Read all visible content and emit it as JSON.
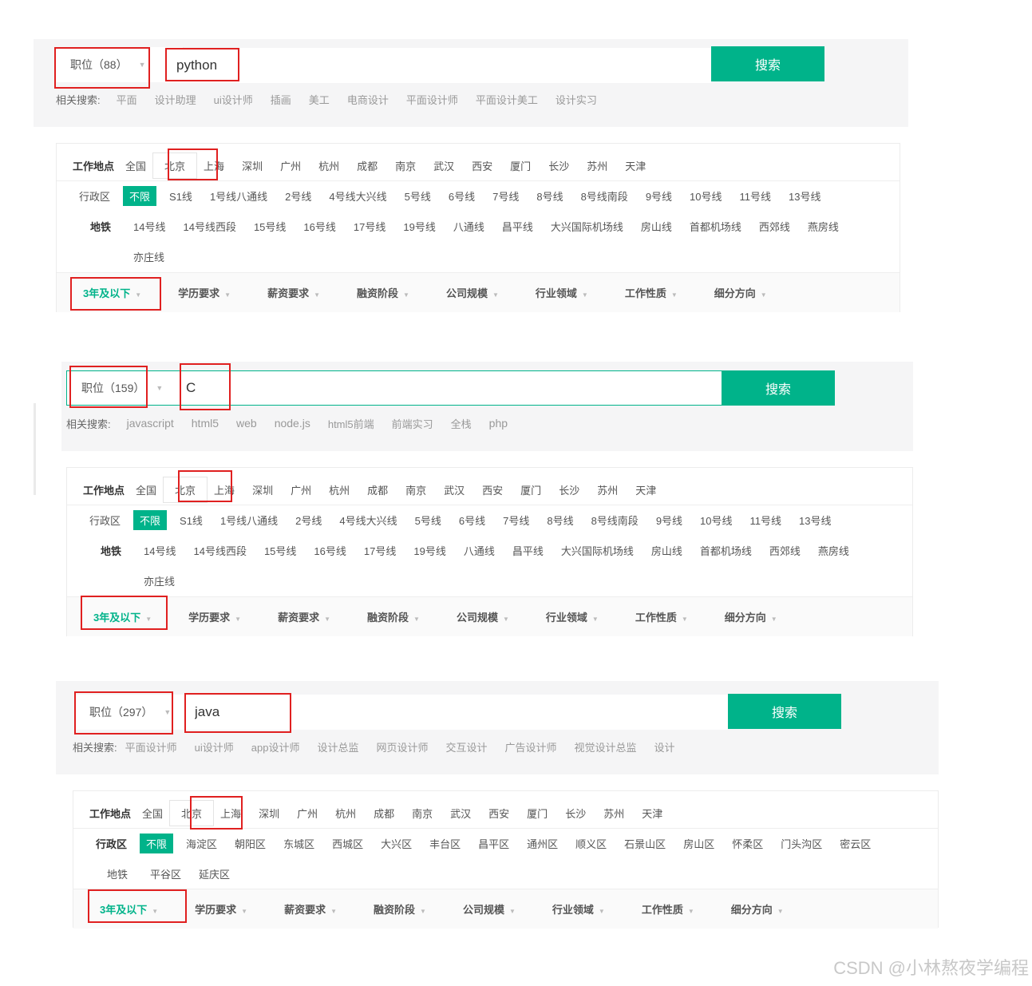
{
  "block1": {
    "position_label": "职位（88）",
    "query": "python",
    "search_button": "搜索",
    "related_label": "相关搜索:",
    "related": [
      "平面",
      "设计助理",
      "ui设计师",
      "插画",
      "美工",
      "电商设计",
      "平面设计师",
      "平面设计美工",
      "设计实习"
    ],
    "location_label": "工作地点",
    "cities": [
      "全国",
      "北京",
      "上海",
      "深圳",
      "广州",
      "杭州",
      "成都",
      "南京",
      "武汉",
      "西安",
      "厦门",
      "长沙",
      "苏州",
      "天津"
    ],
    "district_label": "行政区",
    "unlimited": "不限",
    "subway_label": "地铁",
    "lines_row1": [
      "S1线",
      "1号线八通线",
      "2号线",
      "4号线大兴线",
      "5号线",
      "6号线",
      "7号线",
      "8号线",
      "8号线南段",
      "9号线",
      "10号线",
      "11号线",
      "13号线"
    ],
    "lines_row2": [
      "14号线",
      "14号线西段",
      "15号线",
      "16号线",
      "17号线",
      "19号线",
      "八通线",
      "昌平线",
      "大兴国际机场线",
      "房山线",
      "首都机场线",
      "西郊线",
      "燕房线"
    ],
    "lines_row3": [
      "亦庄线"
    ],
    "bottom": [
      "3年及以下",
      "学历要求",
      "薪资要求",
      "融资阶段",
      "公司规模",
      "行业领域",
      "工作性质",
      "细分方向"
    ]
  },
  "block2": {
    "position_label": "职位（159）",
    "query": "C",
    "search_button": "搜索",
    "related_label": "相关搜索:",
    "related": [
      "javascript",
      "html5",
      "web",
      "node.js",
      "html5前端",
      "前端实习",
      "全栈",
      "php"
    ],
    "location_label": "工作地点",
    "cities": [
      "全国",
      "北京",
      "上海",
      "深圳",
      "广州",
      "杭州",
      "成都",
      "南京",
      "武汉",
      "西安",
      "厦门",
      "长沙",
      "苏州",
      "天津"
    ],
    "district_label": "行政区",
    "unlimited": "不限",
    "subway_label": "地铁",
    "lines_row1": [
      "S1线",
      "1号线八通线",
      "2号线",
      "4号线大兴线",
      "5号线",
      "6号线",
      "7号线",
      "8号线",
      "8号线南段",
      "9号线",
      "10号线",
      "11号线",
      "13号线"
    ],
    "lines_row2": [
      "14号线",
      "14号线西段",
      "15号线",
      "16号线",
      "17号线",
      "19号线",
      "八通线",
      "昌平线",
      "大兴国际机场线",
      "房山线",
      "首都机场线",
      "西郊线",
      "燕房线"
    ],
    "lines_row3": [
      "亦庄线"
    ],
    "bottom": [
      "3年及以下",
      "学历要求",
      "薪资要求",
      "融资阶段",
      "公司规模",
      "行业领域",
      "工作性质",
      "细分方向"
    ]
  },
  "block3": {
    "position_label": "职位（297）",
    "query": "java",
    "search_button": "搜索",
    "related_label": "相关搜索:",
    "related": [
      "平面设计师",
      "ui设计师",
      "app设计师",
      "设计总监",
      "网页设计师",
      "交互设计",
      "广告设计师",
      "视觉设计总监",
      "设计"
    ],
    "location_label": "工作地点",
    "cities": [
      "全国",
      "北京",
      "上海",
      "深圳",
      "广州",
      "杭州",
      "成都",
      "南京",
      "武汉",
      "西安",
      "厦门",
      "长沙",
      "苏州",
      "天津"
    ],
    "district_label": "行政区",
    "unlimited": "不限",
    "districts": [
      "海淀区",
      "朝阳区",
      "东城区",
      "西城区",
      "大兴区",
      "丰台区",
      "昌平区",
      "通州区",
      "顺义区",
      "石景山区",
      "房山区",
      "怀柔区",
      "门头沟区",
      "密云区"
    ],
    "subway_label": "地铁",
    "districts_row2": [
      "平谷区",
      "延庆区"
    ],
    "bottom": [
      "3年及以下",
      "学历要求",
      "薪资要求",
      "融资阶段",
      "公司规模",
      "行业领域",
      "工作性质",
      "细分方向"
    ]
  },
  "watermark": "CSDN @小林熬夜学编程",
  "colors": {
    "accent": "#00b38a",
    "highlight_box": "#e02020"
  }
}
